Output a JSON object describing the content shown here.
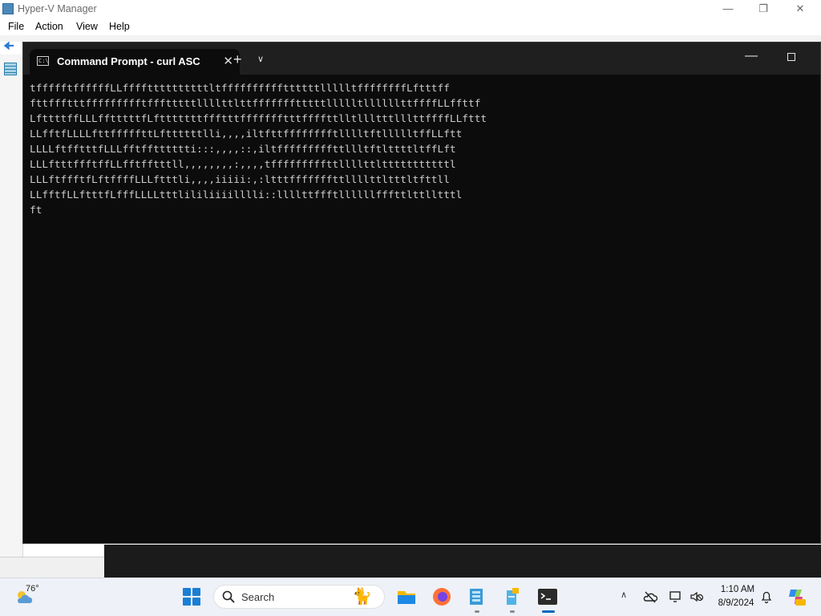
{
  "hyperv": {
    "title": "Hyper-V Manager",
    "menu": [
      "File",
      "Action",
      "View",
      "Help"
    ]
  },
  "terminal": {
    "tab_title": "Command Prompt - curl  ASC",
    "output_lines": [
      "tffffftffffffLLffffttttttttttltffffffffffttttttllllltffffffffLftttff",
      "fttffftttffffffffftffftttttllllttlttffffffftttttllllltllllllttffffLLffttf",
      "LfttttffLLLfftttttfLftttttttffftttffffffftttffffttlltllltttlllttffffLLfttt",
      "LLfftfLLLLfttfffffttLfttttttlli,,,,iltfttfffffffftlllltftllllltffLLftt",
      "LLLLftfftttfLLLfftfftttttti:::,,,,::,iltfffffffffttllltftlttttltffLft",
      "LLLftttffftffLLfftfftttll,,,,,,,,:,,,,tfffffffffttllllttltttttttttttl",
      "LLLftffftfLftffffLLLftttli,,,,iiiii:,:ltttfffffffttllllttltttltfttll",
      "LLfftfLLftttfLfffLLLLtttlililiiiilllli::llllttffftllllllfffttlttlltttl",
      "ft"
    ]
  },
  "taskbar": {
    "temperature": "76°",
    "search_label": "Search",
    "time": "1:10 AM",
    "date": "8/9/2024"
  }
}
